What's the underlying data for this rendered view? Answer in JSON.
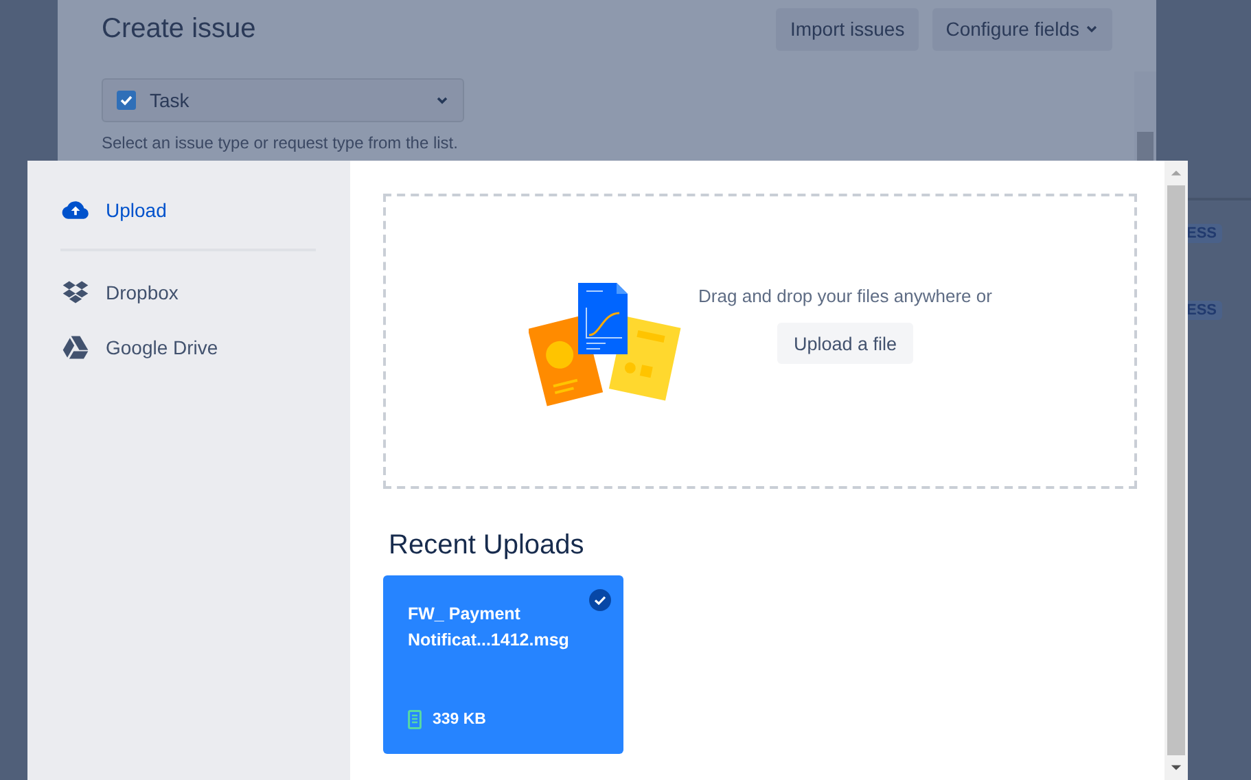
{
  "background_page": {
    "badges": [
      "ESS",
      "ESS"
    ]
  },
  "create_issue": {
    "title": "Create issue",
    "buttons": [
      "Import issues",
      "Configure fields"
    ],
    "type_select": {
      "value": "Task",
      "checked": true
    },
    "hint": "Select an issue type or request type from the list."
  },
  "sidebar": {
    "items": [
      {
        "label": "Upload",
        "selected": true
      },
      {
        "label": "Dropbox",
        "selected": false
      },
      {
        "label": "Google Drive",
        "selected": false
      }
    ]
  },
  "dropzone": {
    "prompt": "Drag and drop your files anywhere or",
    "button": "Upload a file"
  },
  "recent_uploads": {
    "title": "Recent Uploads",
    "files": [
      {
        "name": "FW_ Payment Notificat...1412.msg",
        "size": "339 KB",
        "selected": true
      }
    ]
  }
}
